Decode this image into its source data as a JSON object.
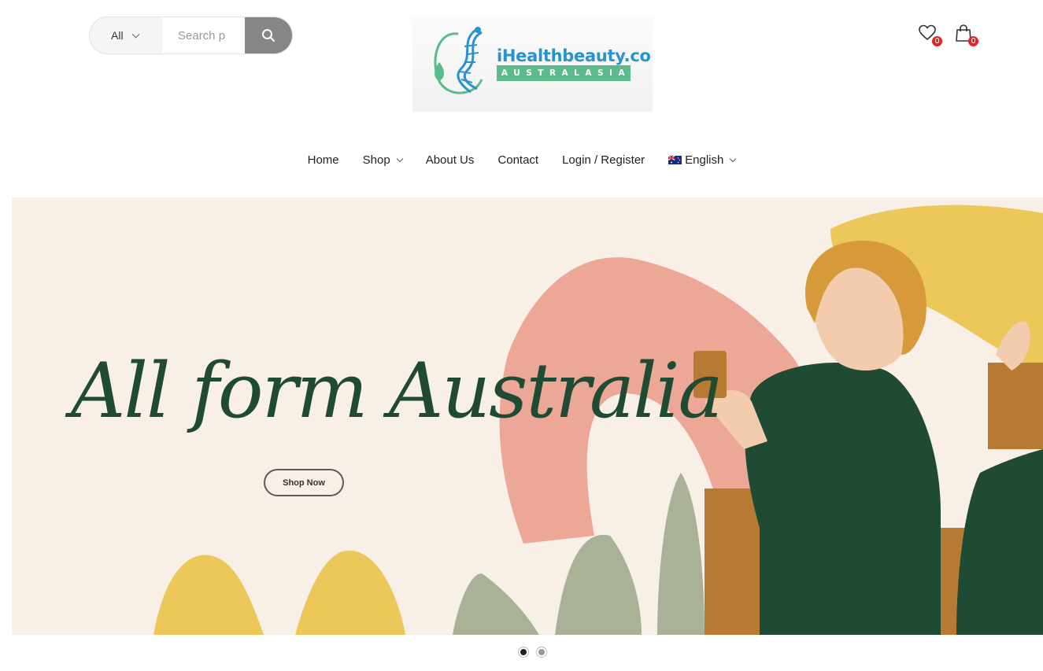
{
  "search": {
    "category_label": "All",
    "placeholder": "Search p"
  },
  "logo": {
    "name": "iHealthbeauty.co",
    "tagline": "AUSTRALASIA"
  },
  "header_icons": {
    "wishlist_count": "0",
    "cart_count": "0"
  },
  "nav": {
    "home": "Home",
    "shop": "Shop",
    "about": "About Us",
    "contact": "Contact",
    "login": "Login / Register",
    "language": "English"
  },
  "hero": {
    "title": "All form Australia",
    "button": "Shop Now",
    "slide_count": 2,
    "active_slide": 1
  },
  "colors": {
    "accent_green": "#1f4a33",
    "badge_red": "#e02424",
    "hero_bg": "#f8efe6"
  }
}
